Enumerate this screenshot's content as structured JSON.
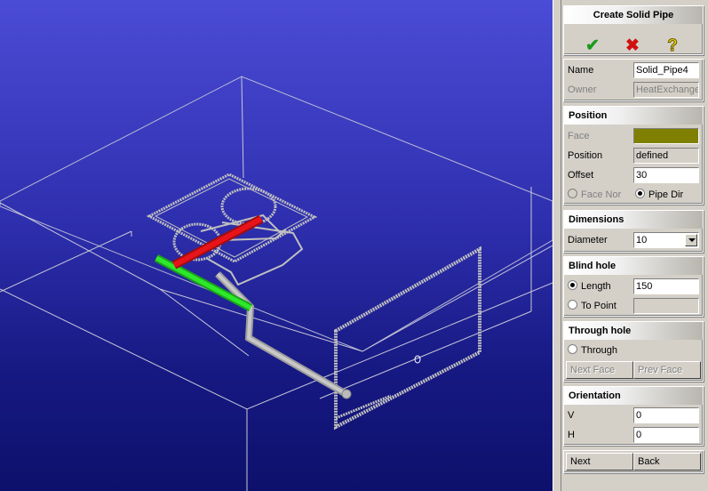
{
  "panel": {
    "title": "Create Solid Pipe",
    "actions": {
      "ok_icon": "check-icon",
      "cancel_icon": "x-icon",
      "help_icon": "question-icon"
    },
    "name_label": "Name",
    "name_value": "Solid_Pipe4",
    "owner_label": "Owner",
    "owner_value": "HeatExchange",
    "position": {
      "header": "Position",
      "face_label": "Face",
      "face_color": "#808000",
      "position_label": "Position",
      "position_value": "defined",
      "offset_label": "Offset",
      "offset_value": "30",
      "face_normal_label": "Face Nor",
      "pipe_dir_label": "Pipe Dir",
      "selected": "pipe_dir"
    },
    "dimensions": {
      "header": "Dimensions",
      "diameter_label": "Diameter",
      "diameter_value": "10"
    },
    "blind_hole": {
      "header": "Blind hole",
      "length_label": "Length",
      "length_value": "150",
      "to_point_label": "To Point",
      "selected": "length"
    },
    "through_hole": {
      "header": "Through hole",
      "through_label": "Through",
      "next_face": "Next Face",
      "prev_face": "Prev Face"
    },
    "orientation": {
      "header": "Orientation",
      "v_label": "V",
      "v_value": "0",
      "h_label": "H",
      "h_value": "0"
    },
    "nav": {
      "next": "Next",
      "back": "Back"
    }
  },
  "colors": {
    "selected_pipe": "#e8141a",
    "highlight_pipe": "#2ee82a",
    "wire": "#c8c8d8"
  }
}
